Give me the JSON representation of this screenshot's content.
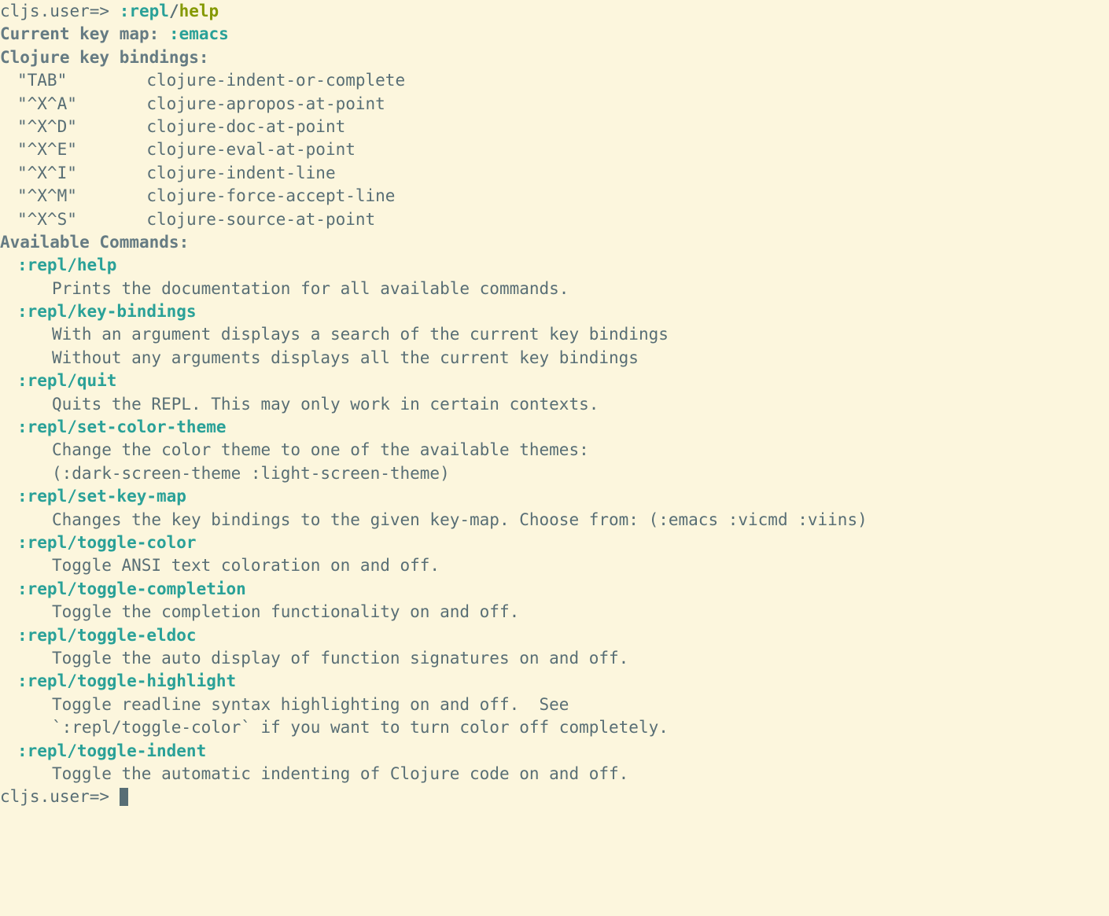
{
  "prompt1": {
    "prefix": "cljs.user=> ",
    "cmd_ns": ":repl",
    "cmd_sep": "/",
    "cmd_name": "help"
  },
  "keymap": {
    "label": "Current key map: ",
    "value": ":emacs"
  },
  "bindings_header": "Clojure key bindings:",
  "bindings": [
    {
      "key": "\"TAB\"",
      "desc": "clojure-indent-or-complete"
    },
    {
      "key": "\"^X^A\"",
      "desc": "clojure-apropos-at-point"
    },
    {
      "key": "\"^X^D\"",
      "desc": "clojure-doc-at-point"
    },
    {
      "key": "\"^X^E\"",
      "desc": "clojure-eval-at-point"
    },
    {
      "key": "\"^X^I\"",
      "desc": "clojure-indent-line"
    },
    {
      "key": "\"^X^M\"",
      "desc": "clojure-force-accept-line"
    },
    {
      "key": "\"^X^S\"",
      "desc": "clojure-source-at-point"
    }
  ],
  "commands_header": "Available Commands:",
  "commands": [
    {
      "name": ":repl/help",
      "desc": [
        "Prints the documentation for all available commands."
      ]
    },
    {
      "name": ":repl/key-bindings",
      "desc": [
        "With an argument displays a search of the current key bindings",
        "Without any arguments displays all the current key bindings"
      ]
    },
    {
      "name": ":repl/quit",
      "desc": [
        "Quits the REPL. This may only work in certain contexts."
      ]
    },
    {
      "name": ":repl/set-color-theme",
      "desc": [
        "Change the color theme to one of the available themes:",
        "(:dark-screen-theme :light-screen-theme)"
      ]
    },
    {
      "name": ":repl/set-key-map",
      "desc": [
        "Changes the key bindings to the given key-map. Choose from: (:emacs :vicmd :viins)"
      ]
    },
    {
      "name": ":repl/toggle-color",
      "desc": [
        "Toggle ANSI text coloration on and off."
      ]
    },
    {
      "name": ":repl/toggle-completion",
      "desc": [
        "Toggle the completion functionality on and off."
      ]
    },
    {
      "name": ":repl/toggle-eldoc",
      "desc": [
        "Toggle the auto display of function signatures on and off."
      ]
    },
    {
      "name": ":repl/toggle-highlight",
      "desc": [
        "Toggle readline syntax highlighting on and off.  See",
        "`:repl/toggle-color` if you want to turn color off completely."
      ]
    },
    {
      "name": ":repl/toggle-indent",
      "desc": [
        "Toggle the automatic indenting of Clojure code on and off."
      ]
    }
  ],
  "prompt2": {
    "prefix": "cljs.user=> "
  }
}
